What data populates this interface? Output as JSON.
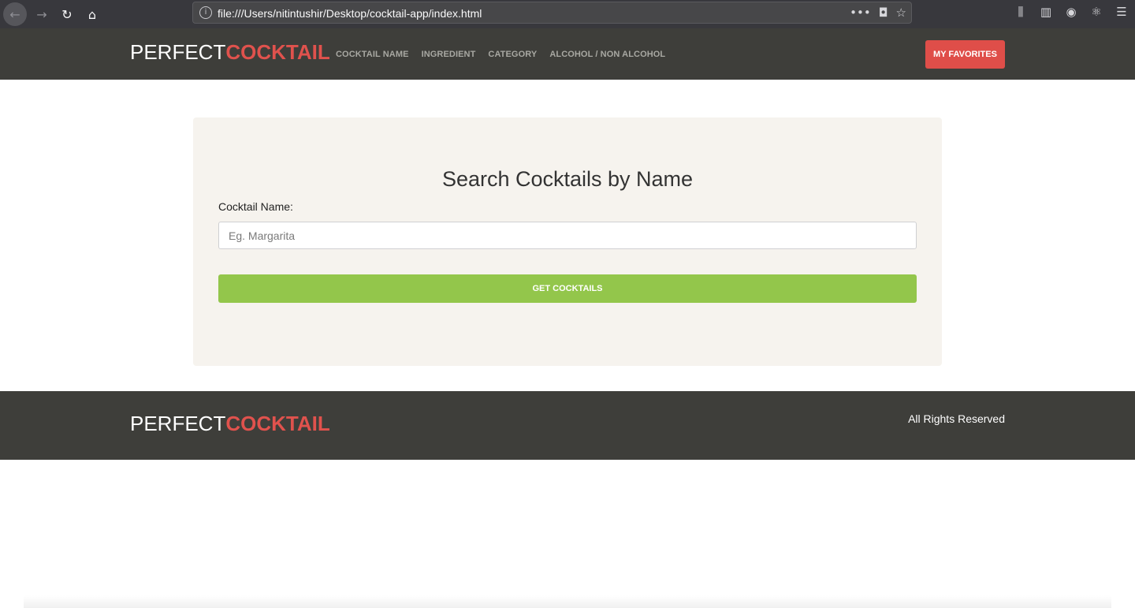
{
  "browser": {
    "url": "file:///Users/nitintushir/Desktop/cocktail-app/index.html",
    "icons": {
      "back": "arrow-left-icon",
      "forward": "arrow-right-icon",
      "reload": "reload-icon",
      "home": "home-icon",
      "info": "info-icon",
      "more": "more-dots-icon",
      "pocket": "pocket-icon",
      "bookmark": "star-icon",
      "library": "library-icon",
      "sidebar": "sidebar-icon",
      "account": "account-icon",
      "extension": "react-devtools-icon",
      "menu": "hamburger-menu-icon"
    }
  },
  "header": {
    "logo_part1": "PERFECT",
    "logo_part2": "COCKTAIL",
    "nav": [
      {
        "label": "COCKTAIL NAME"
      },
      {
        "label": "INGREDIENT"
      },
      {
        "label": "CATEGORY"
      },
      {
        "label": "ALCOHOL / NON ALCOHOL"
      }
    ],
    "favorites_label": "MY FAVORITES"
  },
  "search": {
    "title": "Search Cocktails by Name",
    "field_label": "Cocktail Name:",
    "placeholder": "Eg. Margarita",
    "value": "",
    "button_label": "GET COCKTAILS"
  },
  "footer": {
    "logo_part1": "PERFECT",
    "logo_part2": "COCKTAIL",
    "rights": "All Rights Reserved"
  },
  "colors": {
    "header_bg": "#3e3e3a",
    "accent_red": "#df4e49",
    "button_green": "#93c64b",
    "panel_bg": "#f6f3ee"
  }
}
